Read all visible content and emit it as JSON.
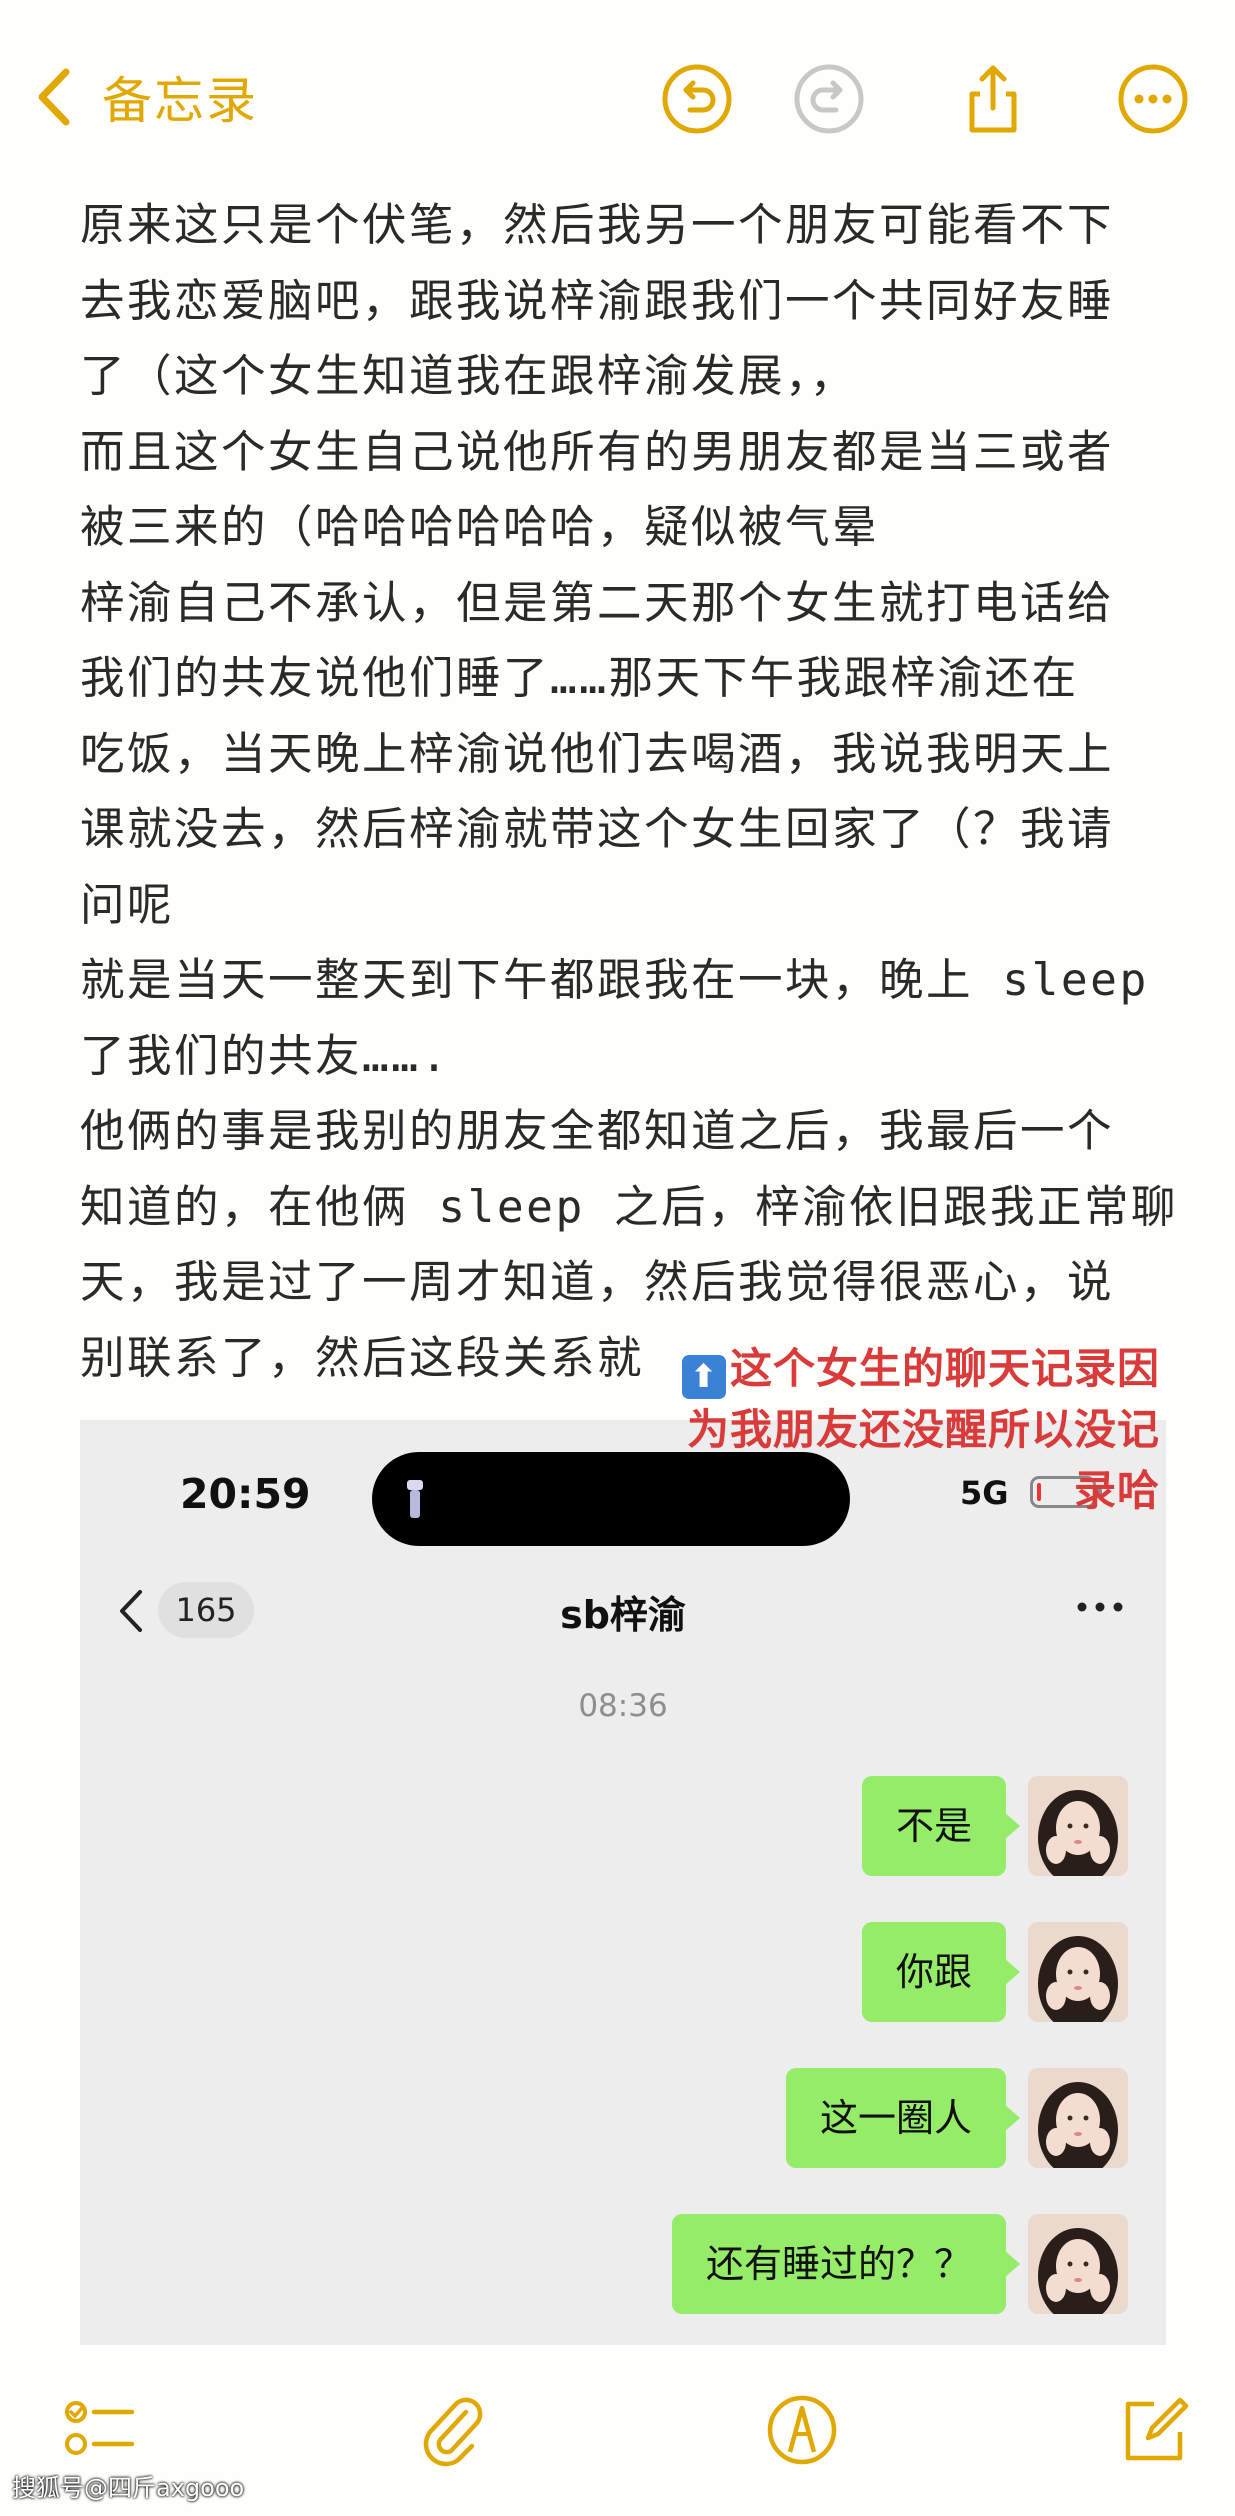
{
  "nav": {
    "back_label": "备忘录"
  },
  "note_lines": [
    "原来这只是个伏笔，然后我另一个朋友可能看不下",
    "去我恋爱脑吧，跟我说梓渝跟我们一个共同好友睡",
    "了（这个女生知道我在跟梓渝发展，，",
    "而且这个女生自己说他所有的男朋友都是当三或者",
    "被三来的（哈哈哈哈哈哈，疑似被气晕",
    "梓渝自己不承认，但是第二天那个女生就打电话给",
    "我们的共友说他们睡了……那天下午我跟梓渝还在",
    "吃饭，当天晚上梓渝说他们去喝酒，我说我明天上",
    "课就没去，然后梓渝就带这个女生回家了（？我请",
    "问呢",
    "就是当天一整天到下午都跟我在一块，晚上 sleep",
    "了我们的共友…….",
    "他俩的事是我别的朋友全都知道之后，我最后一个",
    "知道的，在他俩 sleep 之后，梓渝依旧跟我正常聊",
    "天，我是过了一周才知道，然后我觉得很恶心，说",
    "别联系了，然后这段关系就"
  ],
  "overlay": {
    "arrow_glyph": "⬆",
    "line1": "这个女生的聊天记录因",
    "line2": "为我朋友还没醒所以没记",
    "line3": "录哈"
  },
  "chat": {
    "status_time": "20:59",
    "network": "5G",
    "battery_level": 0.08,
    "unread_count": "165",
    "title": "sb梓渝",
    "timestamp": "08:36",
    "messages": [
      "不是",
      "你跟",
      "这一圈人",
      "还有睡过的？？"
    ]
  },
  "watermark": "搜狐号@四斤axgooo",
  "colors": {
    "accent": "#e0a800",
    "bubble": "#95ec69",
    "overlay_text": "#d93a3a"
  }
}
